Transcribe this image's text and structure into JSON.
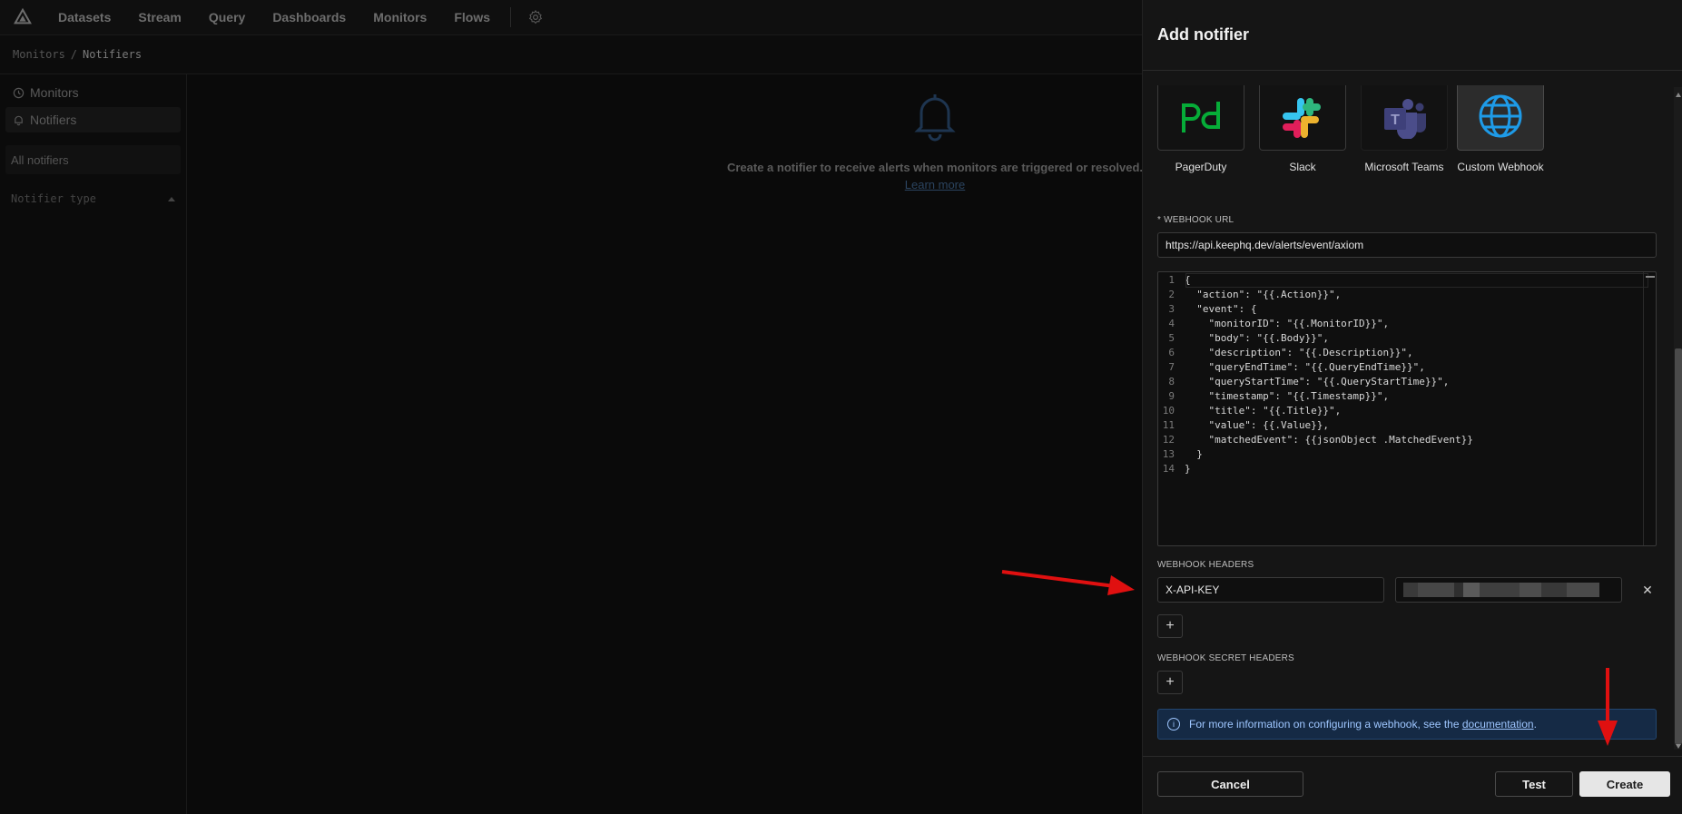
{
  "nav": {
    "items": [
      "Datasets",
      "Stream",
      "Query",
      "Dashboards",
      "Monitors",
      "Flows"
    ]
  },
  "breadcrumb": {
    "parent": "Monitors",
    "separator": "/",
    "current": "Notifiers"
  },
  "sidebar": {
    "items": [
      {
        "label": "Monitors",
        "icon": "monitor-icon"
      },
      {
        "label": "Notifiers",
        "icon": "bell-icon"
      }
    ],
    "filter_label": "All notifiers",
    "type_section": "Notifier type"
  },
  "empty_state": {
    "message": "Create a notifier to receive alerts when monitors are triggered or resolved.",
    "link": "Learn more"
  },
  "drawer": {
    "title": "Add notifier",
    "providers": [
      {
        "label": "PagerDuty",
        "icon": "pagerduty-icon",
        "selected": false
      },
      {
        "label": "Slack",
        "icon": "slack-icon",
        "selected": false
      },
      {
        "label": "Microsoft Teams",
        "icon": "teams-icon",
        "selected": false
      },
      {
        "label": "Custom Webhook",
        "icon": "globe-icon",
        "selected": true
      }
    ],
    "webhook_url": {
      "label": "* WEBHOOK URL",
      "value": "https://api.keephq.dev/alerts/event/axiom"
    },
    "body_editor": {
      "lines": [
        "{",
        "  \"action\": \"{{.Action}}\",",
        "  \"event\": {",
        "    \"monitorID\": \"{{.MonitorID}}\",",
        "    \"body\": \"{{.Body}}\",",
        "    \"description\": \"{{.Description}}\",",
        "    \"queryEndTime\": \"{{.QueryEndTime}}\",",
        "    \"queryStartTime\": \"{{.QueryStartTime}}\",",
        "    \"timestamp\": \"{{.Timestamp}}\",",
        "    \"title\": \"{{.Title}}\",",
        "    \"value\": {{.Value}},",
        "    \"matchedEvent\": {{jsonObject .MatchedEvent}}",
        "  }",
        "}"
      ]
    },
    "headers": {
      "label": "WEBHOOK HEADERS",
      "key": "X-API-KEY",
      "remove_symbol": "✕",
      "add_symbol": "+"
    },
    "secret_headers": {
      "label": "WEBHOOK SECRET HEADERS",
      "add_symbol": "+"
    },
    "info": {
      "icon": "info-icon",
      "text": "For more information on configuring a webhook, see the ",
      "link": "documentation",
      "suffix": "."
    },
    "footer": {
      "cancel": "Cancel",
      "test": "Test",
      "create": "Create"
    }
  },
  "colors": {
    "accent_info": "#152a45",
    "annotation_arrow": "#e01010"
  }
}
